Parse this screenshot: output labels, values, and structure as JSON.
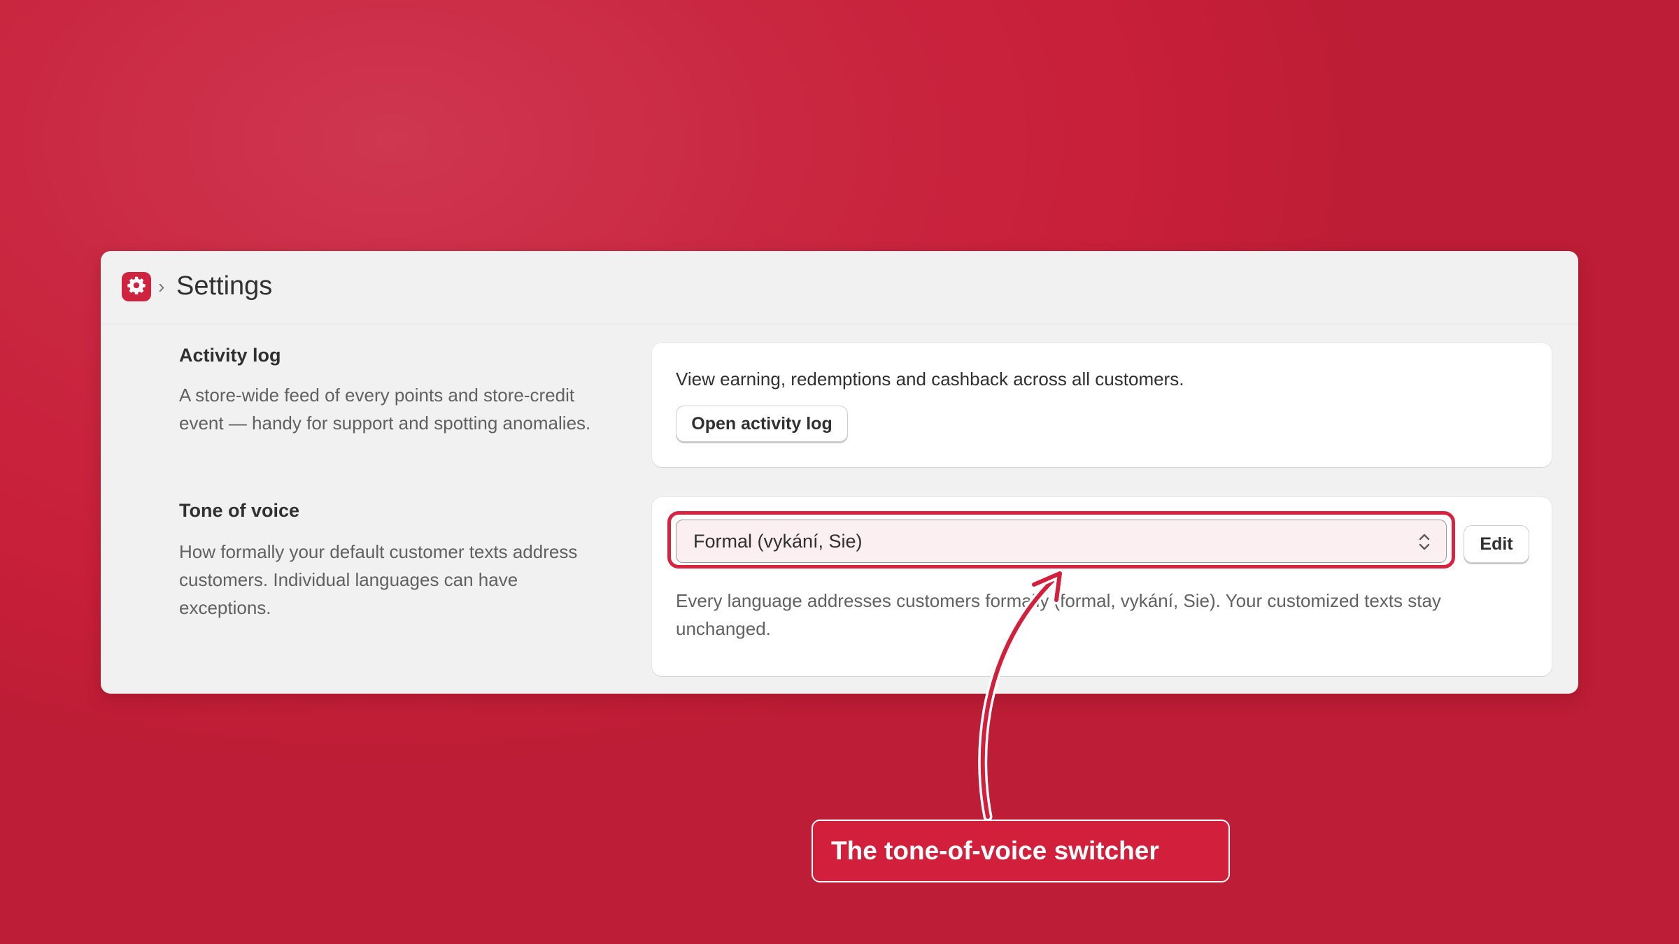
{
  "header": {
    "breadcrumb_separator": "›",
    "title": "Settings",
    "app_icon": "gear-icon"
  },
  "activity_log": {
    "title": "Activity log",
    "description": "A store-wide feed of every points and store-credit event — handy for support and spotting anomalies.",
    "panel_text": "View earning, redemptions and cashback across all customers.",
    "button_label": "Open activity log"
  },
  "tone_of_voice": {
    "title": "Tone of voice",
    "description": "How formally your default customer texts address customers. Individual languages can have exceptions.",
    "selected_value": "Formal (vykání, Sie)",
    "edit_label": "Edit",
    "help_text": "Every language addresses customers formally (formal, vykání, Sie). Your customized texts stay unchanged."
  },
  "annotation": {
    "callout_text": "The tone-of-voice switcher"
  },
  "colors": {
    "background": "#c8203b",
    "accent": "#d7233f",
    "card": "#f1f1f1",
    "panel": "#ffffff"
  }
}
